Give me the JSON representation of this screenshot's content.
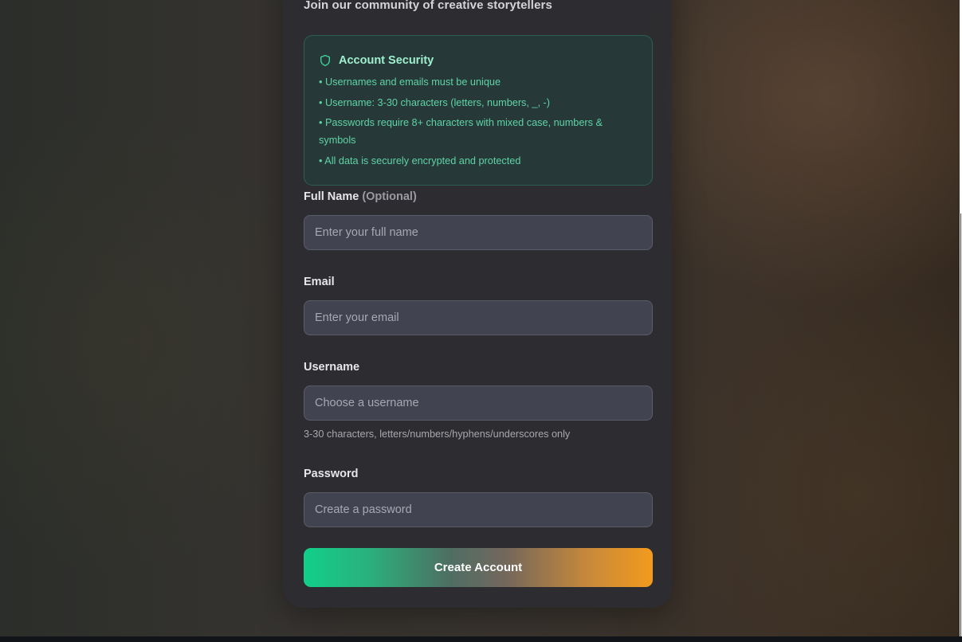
{
  "header": {
    "subtitle": "Join our community of creative storytellers"
  },
  "security": {
    "title": "Account Security",
    "icon": "shield-icon",
    "rules": [
      "• Usernames and emails must be unique",
      "• Username: 3-30 characters (letters, numbers, _, -)",
      "• Passwords require 8+ characters with mixed case, numbers & symbols",
      "• All data is securely encrypted and protected"
    ]
  },
  "form": {
    "full_name": {
      "label": "Full Name",
      "optional": "(Optional)",
      "placeholder": "Enter your full name",
      "value": ""
    },
    "email": {
      "label": "Email",
      "placeholder": "Enter your email",
      "value": ""
    },
    "username": {
      "label": "Username",
      "placeholder": "Choose a username",
      "value": "",
      "hint": "3-30 characters, letters/numbers/hyphens/underscores only"
    },
    "password": {
      "label": "Password",
      "placeholder": "Create a password",
      "value": ""
    },
    "submit_label": "Create Account"
  },
  "colors": {
    "accent_green": "#12cf8a",
    "accent_orange": "#f29a1d",
    "security_text": "#5fd3a6"
  }
}
